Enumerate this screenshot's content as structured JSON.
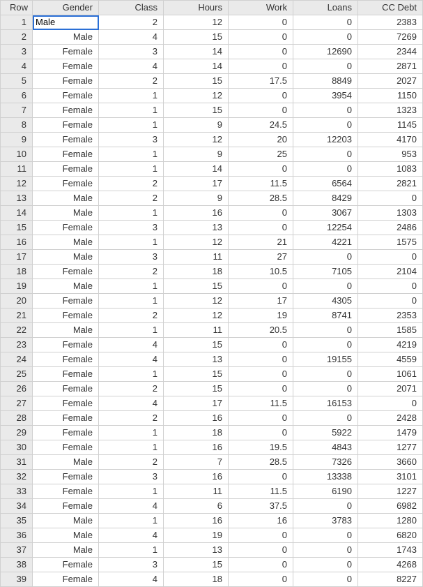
{
  "headers": {
    "row": "Row",
    "gender": "Gender",
    "class": "Class",
    "hours": "Hours",
    "work": "Work",
    "loans": "Loans",
    "ccdebt": "CC Debt"
  },
  "selected_cell": {
    "row": 0,
    "col": "gender"
  },
  "rows": [
    {
      "n": "1",
      "gender": "Male",
      "class": "2",
      "hours": "12",
      "work": "0",
      "loans": "0",
      "ccdebt": "2383"
    },
    {
      "n": "2",
      "gender": "Male",
      "class": "4",
      "hours": "15",
      "work": "0",
      "loans": "0",
      "ccdebt": "7269"
    },
    {
      "n": "3",
      "gender": "Female",
      "class": "3",
      "hours": "14",
      "work": "0",
      "loans": "12690",
      "ccdebt": "2344"
    },
    {
      "n": "4",
      "gender": "Female",
      "class": "4",
      "hours": "14",
      "work": "0",
      "loans": "0",
      "ccdebt": "2871"
    },
    {
      "n": "5",
      "gender": "Female",
      "class": "2",
      "hours": "15",
      "work": "17.5",
      "loans": "8849",
      "ccdebt": "2027"
    },
    {
      "n": "6",
      "gender": "Female",
      "class": "1",
      "hours": "12",
      "work": "0",
      "loans": "3954",
      "ccdebt": "1150"
    },
    {
      "n": "7",
      "gender": "Female",
      "class": "1",
      "hours": "15",
      "work": "0",
      "loans": "0",
      "ccdebt": "1323"
    },
    {
      "n": "8",
      "gender": "Female",
      "class": "1",
      "hours": "9",
      "work": "24.5",
      "loans": "0",
      "ccdebt": "1145"
    },
    {
      "n": "9",
      "gender": "Female",
      "class": "3",
      "hours": "12",
      "work": "20",
      "loans": "12203",
      "ccdebt": "4170"
    },
    {
      "n": "10",
      "gender": "Female",
      "class": "1",
      "hours": "9",
      "work": "25",
      "loans": "0",
      "ccdebt": "953"
    },
    {
      "n": "11",
      "gender": "Female",
      "class": "1",
      "hours": "14",
      "work": "0",
      "loans": "0",
      "ccdebt": "1083"
    },
    {
      "n": "12",
      "gender": "Female",
      "class": "2",
      "hours": "17",
      "work": "11.5",
      "loans": "6564",
      "ccdebt": "2821"
    },
    {
      "n": "13",
      "gender": "Male",
      "class": "2",
      "hours": "9",
      "work": "28.5",
      "loans": "8429",
      "ccdebt": "0"
    },
    {
      "n": "14",
      "gender": "Male",
      "class": "1",
      "hours": "16",
      "work": "0",
      "loans": "3067",
      "ccdebt": "1303"
    },
    {
      "n": "15",
      "gender": "Female",
      "class": "3",
      "hours": "13",
      "work": "0",
      "loans": "12254",
      "ccdebt": "2486"
    },
    {
      "n": "16",
      "gender": "Male",
      "class": "1",
      "hours": "12",
      "work": "21",
      "loans": "4221",
      "ccdebt": "1575"
    },
    {
      "n": "17",
      "gender": "Male",
      "class": "3",
      "hours": "11",
      "work": "27",
      "loans": "0",
      "ccdebt": "0"
    },
    {
      "n": "18",
      "gender": "Female",
      "class": "2",
      "hours": "18",
      "work": "10.5",
      "loans": "7105",
      "ccdebt": "2104"
    },
    {
      "n": "19",
      "gender": "Male",
      "class": "1",
      "hours": "15",
      "work": "0",
      "loans": "0",
      "ccdebt": "0"
    },
    {
      "n": "20",
      "gender": "Female",
      "class": "1",
      "hours": "12",
      "work": "17",
      "loans": "4305",
      "ccdebt": "0"
    },
    {
      "n": "21",
      "gender": "Female",
      "class": "2",
      "hours": "12",
      "work": "19",
      "loans": "8741",
      "ccdebt": "2353"
    },
    {
      "n": "22",
      "gender": "Male",
      "class": "1",
      "hours": "11",
      "work": "20.5",
      "loans": "0",
      "ccdebt": "1585"
    },
    {
      "n": "23",
      "gender": "Female",
      "class": "4",
      "hours": "15",
      "work": "0",
      "loans": "0",
      "ccdebt": "4219"
    },
    {
      "n": "24",
      "gender": "Female",
      "class": "4",
      "hours": "13",
      "work": "0",
      "loans": "19155",
      "ccdebt": "4559"
    },
    {
      "n": "25",
      "gender": "Female",
      "class": "1",
      "hours": "15",
      "work": "0",
      "loans": "0",
      "ccdebt": "1061"
    },
    {
      "n": "26",
      "gender": "Female",
      "class": "2",
      "hours": "15",
      "work": "0",
      "loans": "0",
      "ccdebt": "2071"
    },
    {
      "n": "27",
      "gender": "Female",
      "class": "4",
      "hours": "17",
      "work": "11.5",
      "loans": "16153",
      "ccdebt": "0"
    },
    {
      "n": "28",
      "gender": "Female",
      "class": "2",
      "hours": "16",
      "work": "0",
      "loans": "0",
      "ccdebt": "2428"
    },
    {
      "n": "29",
      "gender": "Female",
      "class": "1",
      "hours": "18",
      "work": "0",
      "loans": "5922",
      "ccdebt": "1479"
    },
    {
      "n": "30",
      "gender": "Female",
      "class": "1",
      "hours": "16",
      "work": "19.5",
      "loans": "4843",
      "ccdebt": "1277"
    },
    {
      "n": "31",
      "gender": "Male",
      "class": "2",
      "hours": "7",
      "work": "28.5",
      "loans": "7326",
      "ccdebt": "3660"
    },
    {
      "n": "32",
      "gender": "Female",
      "class": "3",
      "hours": "16",
      "work": "0",
      "loans": "13338",
      "ccdebt": "3101"
    },
    {
      "n": "33",
      "gender": "Female",
      "class": "1",
      "hours": "11",
      "work": "11.5",
      "loans": "6190",
      "ccdebt": "1227"
    },
    {
      "n": "34",
      "gender": "Female",
      "class": "4",
      "hours": "6",
      "work": "37.5",
      "loans": "0",
      "ccdebt": "6982"
    },
    {
      "n": "35",
      "gender": "Male",
      "class": "1",
      "hours": "16",
      "work": "16",
      "loans": "3783",
      "ccdebt": "1280"
    },
    {
      "n": "36",
      "gender": "Male",
      "class": "4",
      "hours": "19",
      "work": "0",
      "loans": "0",
      "ccdebt": "6820"
    },
    {
      "n": "37",
      "gender": "Male",
      "class": "1",
      "hours": "13",
      "work": "0",
      "loans": "0",
      "ccdebt": "1743"
    },
    {
      "n": "38",
      "gender": "Female",
      "class": "3",
      "hours": "15",
      "work": "0",
      "loans": "0",
      "ccdebt": "4268"
    },
    {
      "n": "39",
      "gender": "Female",
      "class": "4",
      "hours": "18",
      "work": "0",
      "loans": "0",
      "ccdebt": "8227"
    }
  ]
}
